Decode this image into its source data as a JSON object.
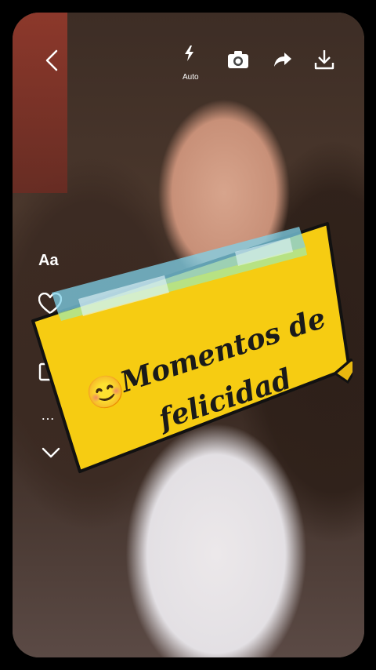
{
  "toolbar": {
    "flash_label": "Auto"
  },
  "side": {
    "text_tool_label": "Aa",
    "more_label": "…"
  },
  "sticker": {
    "emoji": "😊",
    "line1": "Momentos de",
    "line2": "felicidad",
    "paper_color": "#f6cc12",
    "tape_color": "#7fd1ea"
  },
  "icons": [
    "back-icon",
    "flash-icon",
    "camera-icon",
    "share-icon",
    "download-icon",
    "heart-icon",
    "chevron-down-icon"
  ]
}
